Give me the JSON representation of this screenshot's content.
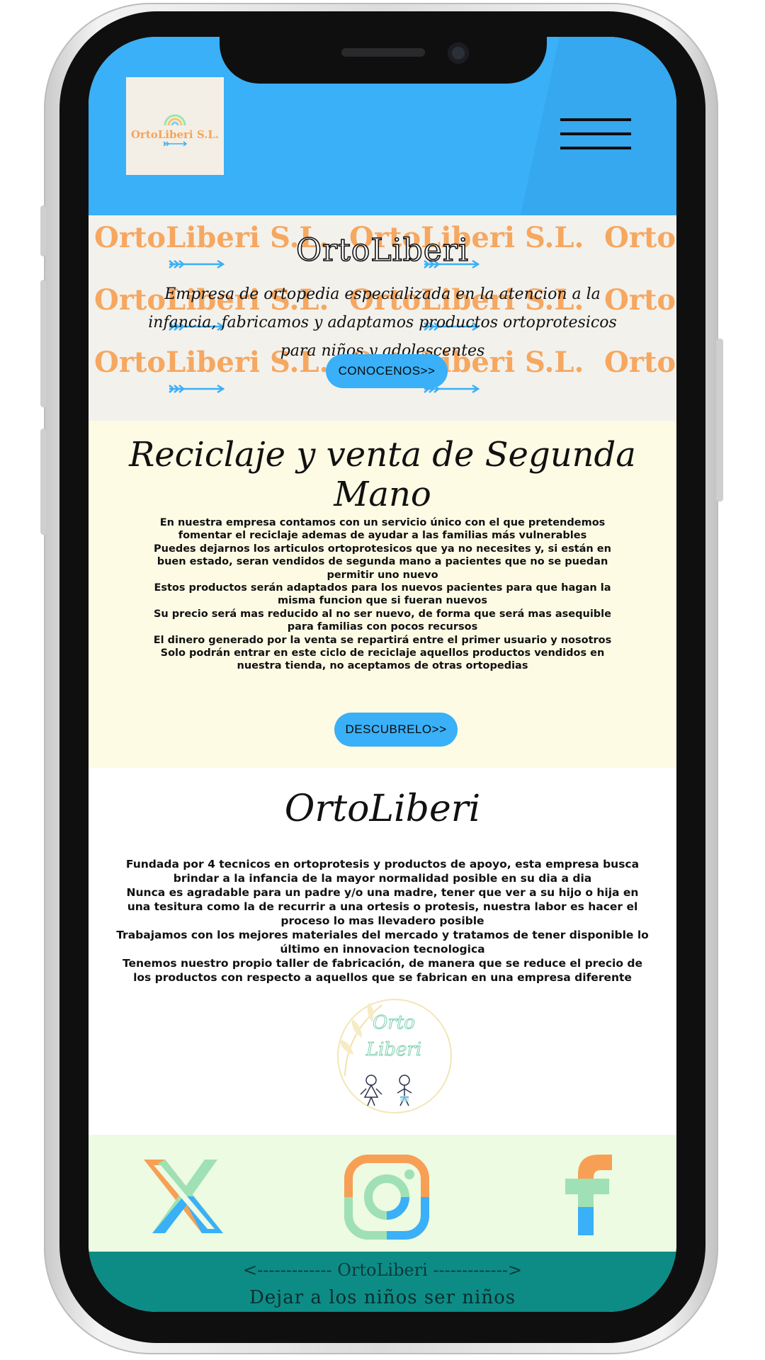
{
  "header": {
    "logo_text": "OrtoLiberi S.L."
  },
  "hero": {
    "pattern_text": "OrtoLiberi S.L.",
    "title": "OrtoLiberi",
    "subtitle": "Empresa de ortopedia especializada en la atencion a la infancia, fabricamos y adaptamos productos ortoprotesicos para niños y adolescentes",
    "button_label": "CONOCENOS>>"
  },
  "recycling": {
    "title": "Reciclaje y venta de Segunda Mano",
    "paragraphs": [
      "En nuestra empresa contamos con un servicio único con el que pretendemos fomentar el reciclaje ademas de ayudar a las familias más vulnerables",
      "Puedes dejarnos los articulos ortoprotesicos que ya no necesites y, si están en buen estado, seran vendidos de segunda mano a pacientes que no se puedan permitir uno nuevo",
      "Estos productos serán adaptados para los nuevos pacientes para que hagan la misma funcion que si fueran nuevos",
      "Su precio será mas reducido al no ser nuevo, de forma que será mas asequible para familias con pocos recursos",
      "El dinero generado por la venta se repartirá entre el primer usuario y nosotros",
      "Solo podrán entrar en este ciclo de reciclaje aquellos productos vendidos en nuestra tienda, no aceptamos de otras ortopedias"
    ],
    "button_label": "DESCUBRELO>>"
  },
  "about": {
    "title": "OrtoLiberi",
    "paragraphs": [
      "Fundada por 4 tecnicos en ortoprotesis y productos de apoyo, esta empresa busca brindar a la infancia de la mayor normalidad posible en su dia a dia",
      "Nunca es agradable para un padre y/o una madre, tener que ver a su hijo o hija en una tesitura como la de recurrir a una ortesis o protesis, nuestra labor es hacer el proceso lo mas llevadero posible",
      "Trabajamos con los mejores materiales del mercado y tratamos de tener disponible lo último en innovacion tecnologica",
      "Tenemos nuestro propio taller de fabricación, de manera que se reduce el precio de los productos con respecto a aquellos que se fabrican en una empresa diferente"
    ],
    "logo_line1": "Orto",
    "logo_line2": "Liberi"
  },
  "social": {
    "icons": [
      "x-icon",
      "instagram-icon",
      "facebook-icon"
    ]
  },
  "footer": {
    "line1": "<------------- OrtoLiberi ------------->",
    "line2": "Dejar a los niños ser niños"
  },
  "colors": {
    "header_blue": "#39b0f7",
    "brand_orange": "#f7a459",
    "recycle_bg": "#fdfbe4",
    "social_bg": "#ecfbe2",
    "footer_teal": "#0d8c86"
  }
}
